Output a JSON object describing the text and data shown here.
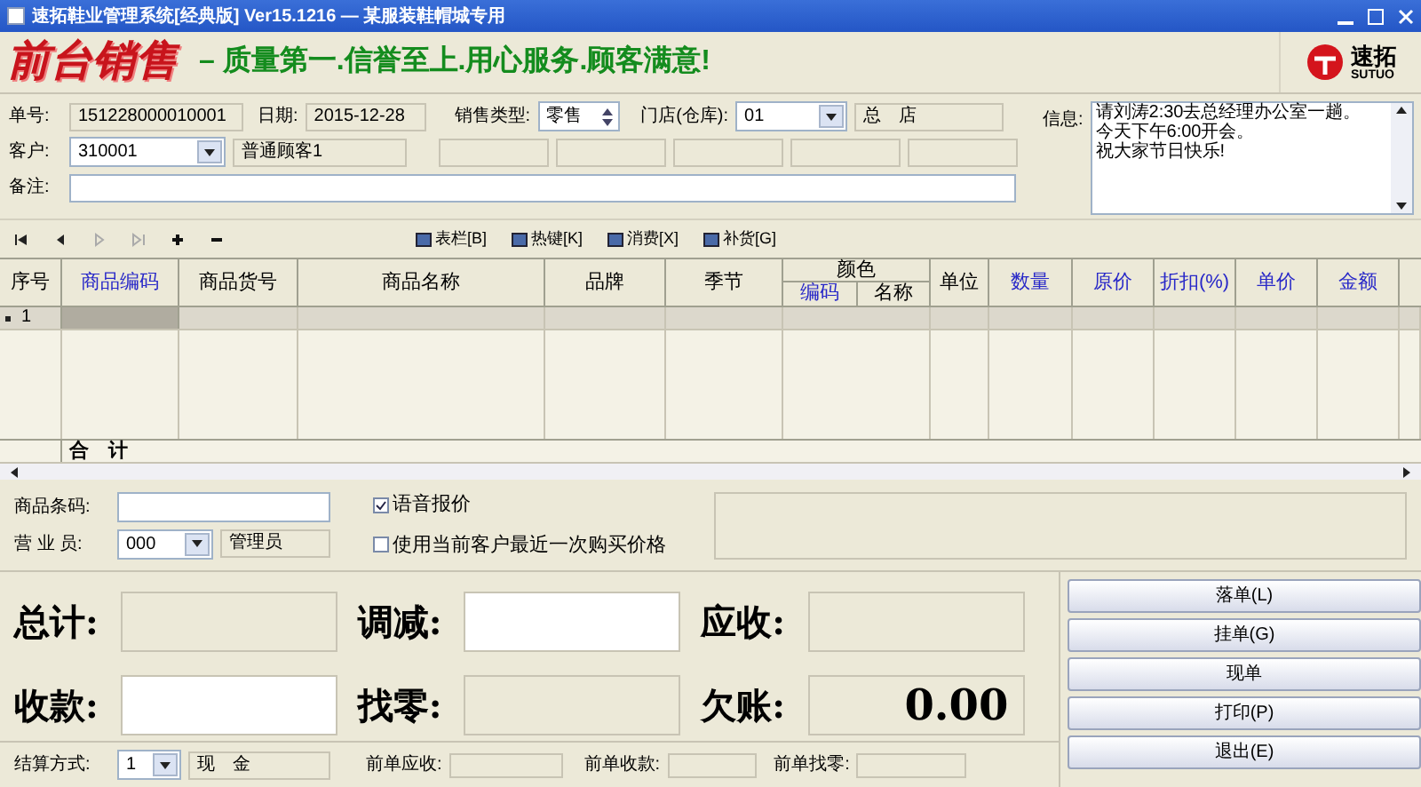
{
  "window": {
    "title": "速拓鞋业管理系统[经典版] Ver15.1216 — 某服装鞋帽城专用"
  },
  "banner": {
    "title": "前台销售",
    "slogan": "– 质量第一.信誉至上.用心服务.顾客满意!",
    "logo_text": "速拓",
    "logo_sub": "SUTUO"
  },
  "form": {
    "order_label": "单号:",
    "order_value": "151228000010001",
    "date_label": "日期:",
    "date_value": "2015-12-28",
    "type_label": "销售类型:",
    "type_value": "零售",
    "store_label": "门店(仓库):",
    "store_value": "01",
    "store_name": "总　店",
    "customer_label": "客户:",
    "customer_value": "310001",
    "customer_name": "普通顾客1",
    "note_label": "备注:",
    "info_label": "信息:",
    "info_lines": [
      "请刘涛2:30去总经理办公室一趟。",
      "今天下午6:00开会。",
      "祝大家节日快乐!"
    ]
  },
  "toolbar": [
    {
      "label": "表栏[B]"
    },
    {
      "label": "热键[K]"
    },
    {
      "label": "消费[X]"
    },
    {
      "label": "补货[G]"
    }
  ],
  "table": {
    "columns": [
      {
        "label": "序号",
        "highlighted": false
      },
      {
        "label": "商品编码",
        "highlighted": true
      },
      {
        "label": "商品货号",
        "highlighted": false
      },
      {
        "label": "商品名称",
        "highlighted": false
      },
      {
        "label": "品牌",
        "highlighted": false
      },
      {
        "label": "季节",
        "highlighted": false
      },
      {
        "label": "颜色",
        "children": [
          {
            "label": "编码",
            "highlighted": true
          },
          {
            "label": "名称",
            "highlighted": false
          }
        ]
      },
      {
        "label": "单位",
        "highlighted": false
      },
      {
        "label": "数量",
        "highlighted": true
      },
      {
        "label": "原价",
        "highlighted": true
      },
      {
        "label": "折扣(%)",
        "highlighted": true
      },
      {
        "label": "单价",
        "highlighted": true
      },
      {
        "label": "金额",
        "highlighted": true
      }
    ],
    "rows": [
      {
        "number": "1",
        "selected": true
      }
    ],
    "total_label": "合　计"
  },
  "entry": {
    "barcode_label": "商品条码:",
    "salesman_label": "营 业 员:",
    "salesman_value": "000",
    "salesman_name": "管理员",
    "options": [
      {
        "label": "语音报价",
        "checked": true
      },
      {
        "label": "使用当前客户最近一次购买价格",
        "checked": false
      }
    ]
  },
  "totals": [
    {
      "label": "总计:",
      "editable": false
    },
    {
      "label": "调减:",
      "editable": true
    },
    {
      "label": "应收:",
      "editable": false
    },
    {
      "label": "收款:",
      "editable": true
    },
    {
      "label": "找零:",
      "editable": false
    },
    {
      "label": "欠账:",
      "value": "0.00",
      "editable": false
    }
  ],
  "buttons": [
    "落单(L)",
    "挂单(G)",
    "现单",
    "打印(P)",
    "退出(E)"
  ],
  "footer": {
    "payment_label": "结算方式:",
    "payment_value": "1",
    "payment_name": "现　金",
    "prev_due_label": "前单应收:",
    "prev_paid_label": "前单收款:",
    "prev_change_label": "前单找零:"
  }
}
